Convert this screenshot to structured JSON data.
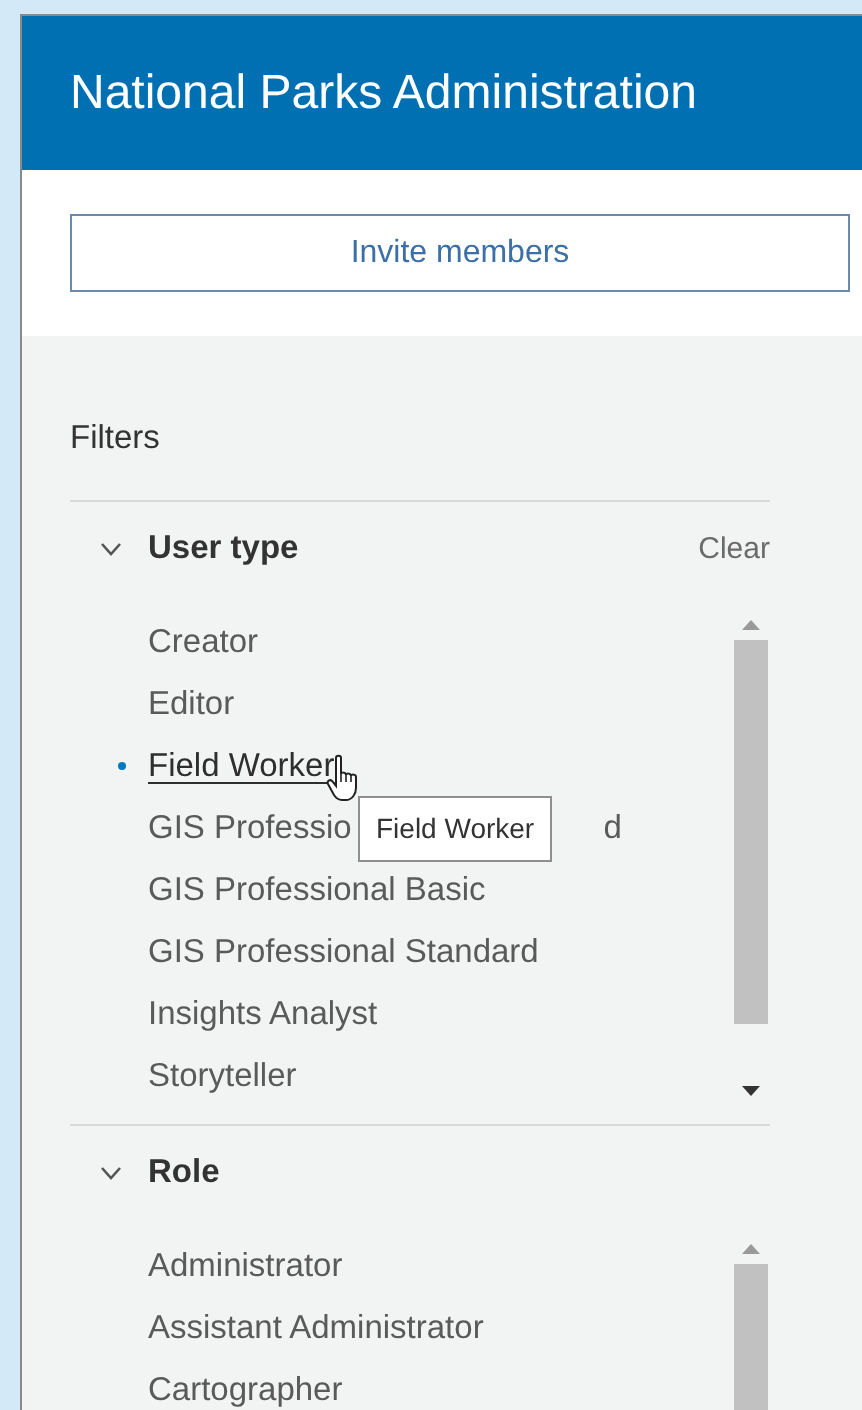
{
  "header": {
    "title": "National Parks Administration"
  },
  "invite_button": {
    "label": "Invite members"
  },
  "filters": {
    "title": "Filters",
    "groups": [
      {
        "title": "User type",
        "expanded": true,
        "clear": "Clear",
        "items": [
          {
            "label": "Creator",
            "selected": false
          },
          {
            "label": "Editor",
            "selected": false
          },
          {
            "label": "Field Worker",
            "selected": true
          },
          {
            "label": "GIS Professio",
            "label_tail": "d",
            "selected": false
          },
          {
            "label": "GIS Professional Basic",
            "selected": false
          },
          {
            "label": "GIS Professional Standard",
            "selected": false
          },
          {
            "label": "Insights Analyst",
            "selected": false
          },
          {
            "label": "Storyteller",
            "selected": false
          }
        ],
        "tooltip": "Field Worker"
      },
      {
        "title": "Role",
        "expanded": true,
        "items": [
          {
            "label": "Administrator",
            "selected": false
          },
          {
            "label": "Assistant Administrator",
            "selected": false
          },
          {
            "label": "Cartographer",
            "selected": false
          }
        ]
      }
    ]
  }
}
